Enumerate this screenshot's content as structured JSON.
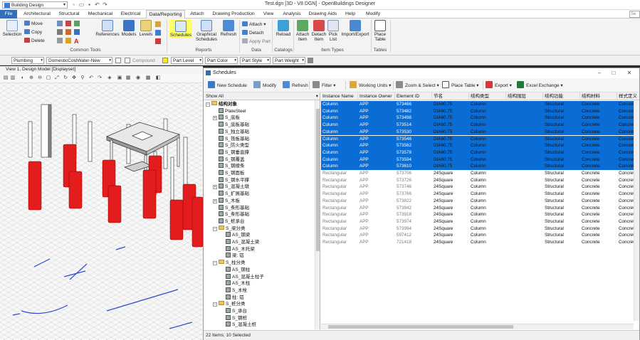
{
  "title_bar": {
    "workspace": "Building Design",
    "document_title": "Test.dgn [3D - V8 DGN] - OpenBuildings Designer"
  },
  "ribbon_tabs": [
    "File",
    "Architectural",
    "Structural",
    "Mechanical",
    "Electrical",
    "Data/Reporting",
    "Attach",
    "Drawing Production",
    "View",
    "Analysis",
    "Drawing Aids",
    "Help",
    "Modify"
  ],
  "active_tab": "Data/Reporting",
  "search_placeholder": "Se",
  "ribbon": {
    "common_tools": {
      "label": "Common Tools",
      "selection": "Selection",
      "move": "Move",
      "copy": "Copy",
      "delete": "Delete",
      "references": "References",
      "models": "Models",
      "levels": "Levels"
    },
    "reports": {
      "label": "Reports",
      "schedules": "Schedules",
      "graphical_schedules": "Graphical Schedules",
      "refresh": "Refresh"
    },
    "data": {
      "label": "Data",
      "attach": "Attach",
      "detach": "Detach",
      "apply_part": "Apply Part"
    },
    "catalogs": {
      "label": "Catalogs",
      "reload": "Reload"
    },
    "item_types": {
      "label": "Item Types",
      "attach_item": "Attach Item",
      "detach_item": "Detach Item",
      "pick_list": "Pick List",
      "import_export": "Import/Export"
    },
    "tables": {
      "label": "Tables",
      "place_table": "Place Table"
    }
  },
  "attr_bar": {
    "discipline": "Plumbing",
    "system": "DomesticColdWater-New",
    "compound": "Compound",
    "part_level": "Part Level",
    "part_color": "Part Color",
    "part_style": "Part Style",
    "part_weight": "Part Weight"
  },
  "view": {
    "title": "View 1, Design Model [Displayset]"
  },
  "schedules_window": {
    "title": "Schedules",
    "toolbar": {
      "new_schedule": "New Schedule",
      "modify": "Modify",
      "refresh": "Refresh",
      "filter": "Filter",
      "working_units": "Working Units",
      "zoom_select": "Zoom & Select",
      "place_table": "Place Table",
      "export": "Export",
      "excel_exchange": "Excel Exchange"
    },
    "tree": {
      "header": "Show All",
      "nodes": [
        {
          "label": "结构对象",
          "level": 0,
          "type": "folder",
          "exp": "−"
        },
        {
          "label": "PlateSteel",
          "level": 1,
          "type": "item",
          "exp": ""
        },
        {
          "label": "S_底板",
          "level": 1,
          "type": "item",
          "exp": "+"
        },
        {
          "label": "S_底板基础",
          "level": 1,
          "type": "item",
          "exp": ""
        },
        {
          "label": "S_独立基础",
          "level": 1,
          "type": "item",
          "exp": ""
        },
        {
          "label": "S_筏板基础",
          "level": 1,
          "type": "item",
          "exp": ""
        },
        {
          "label": "S_防火类型",
          "level": 1,
          "type": "item",
          "exp": ""
        },
        {
          "label": "S_钢垂直撑",
          "level": 1,
          "type": "item",
          "exp": ""
        },
        {
          "label": "S_钢覆盖",
          "level": 1,
          "type": "item",
          "exp": ""
        },
        {
          "label": "S_钢檩条",
          "level": 1,
          "type": "item",
          "exp": ""
        },
        {
          "label": "S_钢面板",
          "level": 1,
          "type": "item",
          "exp": ""
        },
        {
          "label": "S_钢水平撑",
          "level": 1,
          "type": "item",
          "exp": ""
        },
        {
          "label": "S_混凝土墩",
          "level": 1,
          "type": "item",
          "exp": "+"
        },
        {
          "label": "S_扩展基础",
          "level": 1,
          "type": "item",
          "exp": ""
        },
        {
          "label": "S_木板",
          "level": 1,
          "type": "item",
          "exp": "+"
        },
        {
          "label": "S_条形基础",
          "level": 1,
          "type": "item",
          "exp": ""
        },
        {
          "label": "S_条形基础",
          "level": 1,
          "type": "item",
          "exp": ""
        },
        {
          "label": "S_桩承台",
          "level": 1,
          "type": "item",
          "exp": ""
        },
        {
          "label": "S_梁分类",
          "level": 1,
          "type": "folder",
          "exp": "−"
        },
        {
          "label": "AS_钢梁",
          "level": 2,
          "type": "item",
          "exp": ""
        },
        {
          "label": "AS_混凝土梁",
          "level": 2,
          "type": "item",
          "exp": ""
        },
        {
          "label": "AS_木托梁",
          "level": 2,
          "type": "item",
          "exp": ""
        },
        {
          "label": "梁: 铝",
          "level": 2,
          "type": "item",
          "exp": ""
        },
        {
          "label": "S_柱分类",
          "level": 1,
          "type": "folder",
          "exp": "−"
        },
        {
          "label": "AS_钢柱",
          "level": 2,
          "type": "item",
          "exp": ""
        },
        {
          "label": "AS_混凝土柱子",
          "level": 2,
          "type": "item",
          "exp": ""
        },
        {
          "label": "AS_木柱",
          "level": 2,
          "type": "item",
          "exp": ""
        },
        {
          "label": "S_木栓",
          "level": 2,
          "type": "item",
          "exp": ""
        },
        {
          "label": "柱: 铝",
          "level": 2,
          "type": "item",
          "exp": ""
        },
        {
          "label": "S_桩分类",
          "level": 1,
          "type": "folder",
          "exp": "−"
        },
        {
          "label": "S_承台",
          "level": 2,
          "type": "item",
          "exp": ""
        },
        {
          "label": "S_钢桩",
          "level": 2,
          "type": "item",
          "exp": ""
        },
        {
          "label": "S_混凝土桩",
          "level": 2,
          "type": "item",
          "exp": ""
        }
      ]
    },
    "grid": {
      "columns": [
        "Instance Name",
        "Instance Owner",
        "Element ID",
        "节名",
        "结构类型",
        "结构围层",
        "结构功能",
        "结构材料",
        "样式定义"
      ],
      "rows": [
        {
          "selected": true,
          "cells": [
            "Column",
            "APP",
            "573466",
            "DIA60.75",
            "Column",
            "",
            "Structural",
            "Concrete",
            "Concrete"
          ]
        },
        {
          "selected": true,
          "cells": [
            "Column",
            "APP",
            "573482",
            "DIA60.75",
            "Column",
            "",
            "Structural",
            "Concrete",
            "Concrete"
          ]
        },
        {
          "selected": true,
          "cells": [
            "Column",
            "APP",
            "573498",
            "DIA60.75",
            "Column",
            "",
            "Structural",
            "Concrete",
            "Concrete"
          ]
        },
        {
          "selected": true,
          "cells": [
            "Column",
            "APP",
            "573514",
            "DIA60.75",
            "Column",
            "",
            "Structural",
            "Concrete",
            "Concrete"
          ]
        },
        {
          "selected": true,
          "cells": [
            "Column",
            "APP",
            "573530",
            "DIA60.75",
            "Column",
            "",
            "Structural",
            "Concrete",
            "Concrete"
          ]
        },
        {
          "selected": true,
          "cells": [
            "Column",
            "APP",
            "573546",
            "DIA60.75",
            "Column",
            "",
            "Structural",
            "Concrete",
            "Concrete"
          ]
        },
        {
          "selected": true,
          "cells": [
            "Column",
            "APP",
            "573562",
            "DIA60.75",
            "Column",
            "",
            "Structural",
            "Concrete",
            "Concrete"
          ]
        },
        {
          "selected": true,
          "cells": [
            "Column",
            "APP",
            "573578",
            "DIA60.75",
            "Column",
            "",
            "Structural",
            "Concrete",
            "Concrete"
          ]
        },
        {
          "selected": true,
          "cells": [
            "Column",
            "APP",
            "573594",
            "DIA60.75",
            "Column",
            "",
            "Structural",
            "Concrete",
            "Concrete"
          ]
        },
        {
          "selected": true,
          "cells": [
            "Column",
            "APP",
            "573610",
            "DIA60.75",
            "Column",
            "",
            "Structural",
            "Concrete",
            "Concrete"
          ]
        },
        {
          "selected": false,
          "cells": [
            "Rectangular",
            "APP",
            "573706",
            "24Square",
            "Column",
            "",
            "Structural",
            "Concrete",
            "Concrete"
          ]
        },
        {
          "selected": false,
          "cells": [
            "Rectangular",
            "APP",
            "573726",
            "24Square",
            "Column",
            "",
            "Structural",
            "Concrete",
            "Concrete"
          ]
        },
        {
          "selected": false,
          "cells": [
            "Rectangular",
            "APP",
            "573746",
            "24Square",
            "Column",
            "",
            "Structural",
            "Concrete",
            "Concrete"
          ]
        },
        {
          "selected": false,
          "cells": [
            "Rectangular",
            "APP",
            "573766",
            "24Square",
            "Column",
            "",
            "Structural",
            "Concrete",
            "Concrete"
          ]
        },
        {
          "selected": false,
          "cells": [
            "Rectangular",
            "APP",
            "573822",
            "24Square",
            "Column",
            "",
            "Structural",
            "Concrete",
            "Concrete"
          ]
        },
        {
          "selected": false,
          "cells": [
            "Rectangular",
            "APP",
            "573842",
            "24Square",
            "Column",
            "",
            "Structural",
            "Concrete",
            "Concrete"
          ]
        },
        {
          "selected": false,
          "cells": [
            "Rectangular",
            "APP",
            "573918",
            "24Square",
            "Column",
            "",
            "Structural",
            "Concrete",
            "Concrete"
          ]
        },
        {
          "selected": false,
          "cells": [
            "Rectangular",
            "APP",
            "573974",
            "24Square",
            "Column",
            "",
            "Structural",
            "Concrete",
            "Concrete"
          ]
        },
        {
          "selected": false,
          "cells": [
            "Rectangular",
            "APP",
            "573994",
            "24Square",
            "Column",
            "",
            "Structural",
            "Concrete",
            "Concrete"
          ]
        },
        {
          "selected": false,
          "cells": [
            "Rectangular",
            "APP",
            "597412",
            "24Square",
            "Column",
            "",
            "Structural",
            "Concrete",
            "Concrete"
          ]
        },
        {
          "selected": false,
          "cells": [
            "Rectangular",
            "APP",
            "721418",
            "24Square",
            "Column",
            "",
            "Structural",
            "Concrete",
            "Concrete"
          ]
        }
      ]
    },
    "status": "22 Items; 10 Selected"
  },
  "colors": {
    "file_tab": "#2f6fbe",
    "selection_row": "#0a6dd6",
    "highlight": "#ffff66",
    "column_red": "#e31d1d"
  }
}
